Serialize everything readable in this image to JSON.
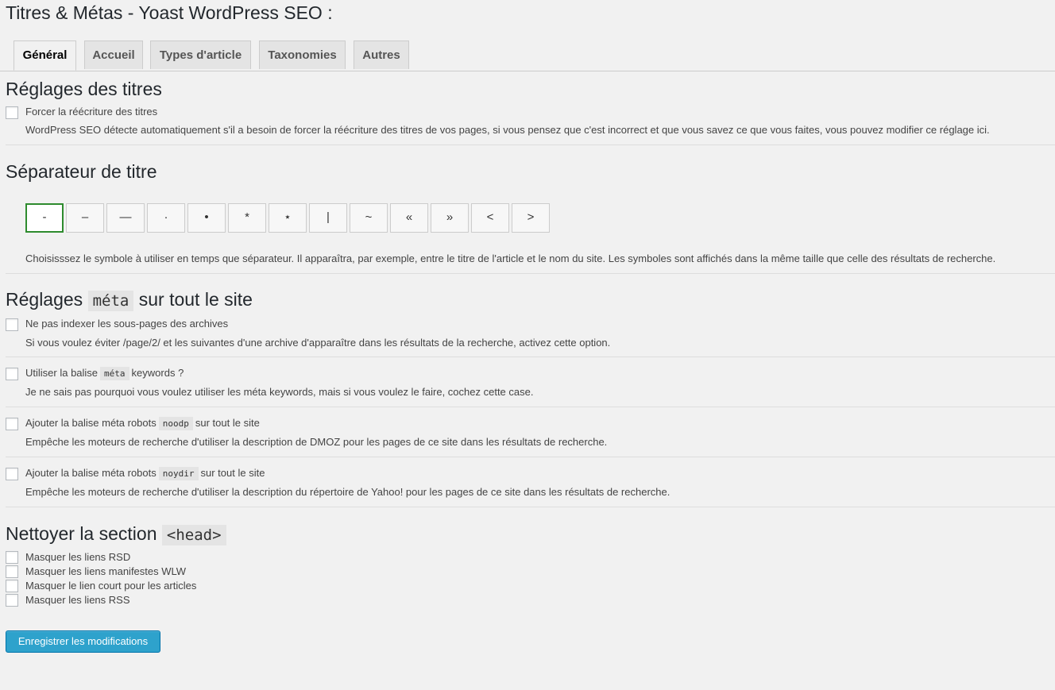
{
  "page": {
    "title": "Titres & Métas - Yoast WordPress SEO :"
  },
  "tabs": [
    {
      "label": "Général",
      "active": true
    },
    {
      "label": "Accueil",
      "active": false
    },
    {
      "label": "Types d'article",
      "active": false
    },
    {
      "label": "Taxonomies",
      "active": false
    },
    {
      "label": "Autres",
      "active": false
    }
  ],
  "titles_section": {
    "heading": "Réglages des titres",
    "force_rewrite": {
      "label": "Forcer la réécriture des titres",
      "checked": false,
      "description": "WordPress SEO détecte automatiquement s'il a besoin de forcer la réécriture des titres de vos pages, si vous pensez que c'est incorrect et que vous savez ce que vous faites, vous pouvez modifier ce réglage ici."
    }
  },
  "separator_section": {
    "heading": "Séparateur de titre",
    "symbols": [
      "-",
      "–",
      "—",
      "·",
      "•",
      "*",
      "⋆",
      "|",
      "~",
      "«",
      "»",
      "<",
      ">"
    ],
    "selected_index": 0,
    "description": "Choisisssez le symbole à utiliser en temps que séparateur. Il apparaîtra, par exemple, entre le titre de l'article et le nom du site. Les symboles sont affichés dans la même taille que celle des résultats de recherche."
  },
  "meta_section": {
    "heading_prefix": "Réglages",
    "heading_code": "méta",
    "heading_suffix": "sur tout le site",
    "noindex_subpages": {
      "label": "Ne pas indexer les sous-pages des archives",
      "checked": false,
      "description": "Si vous voulez éviter /page/2/ et les suivantes d'une archive d'apparaître dans les résultats de la recherche, activez cette option."
    },
    "meta_keywords": {
      "label_prefix": "Utiliser la balise",
      "label_code": "méta",
      "label_suffix": "keywords ?",
      "checked": false,
      "description": "Je ne sais pas pourquoi vous voulez utiliser les méta keywords, mais si vous voulez le faire, cochez cette case."
    },
    "noodp": {
      "label_prefix": "Ajouter la balise méta robots",
      "label_code": "noodp",
      "label_suffix": "sur tout le site",
      "checked": false,
      "description": "Empêche les moteurs de recherche d'utiliser la description de DMOZ pour les pages de ce site dans les résultats de recherche."
    },
    "noydir": {
      "label_prefix": "Ajouter la balise méta robots",
      "label_code": "noydir",
      "label_suffix": "sur tout le site",
      "checked": false,
      "description": "Empêche les moteurs de recherche d'utiliser la description du répertoire de Yahoo! pour les pages de ce site dans les résultats de recherche."
    }
  },
  "head_section": {
    "heading_prefix": "Nettoyer la section",
    "heading_code": "<head>",
    "options": [
      {
        "label": "Masquer les liens RSD",
        "checked": false
      },
      {
        "label": "Masquer les liens manifestes WLW",
        "checked": false
      },
      {
        "label": "Masquer le lien court pour les articles",
        "checked": false
      },
      {
        "label": "Masquer les liens RSS",
        "checked": false
      }
    ]
  },
  "submit": {
    "label": "Enregistrer les modifications"
  },
  "colors": {
    "primary_button": "#2ea2cc",
    "selected_separator_border": "#2e8b2e",
    "background": "#f1f1f1"
  }
}
